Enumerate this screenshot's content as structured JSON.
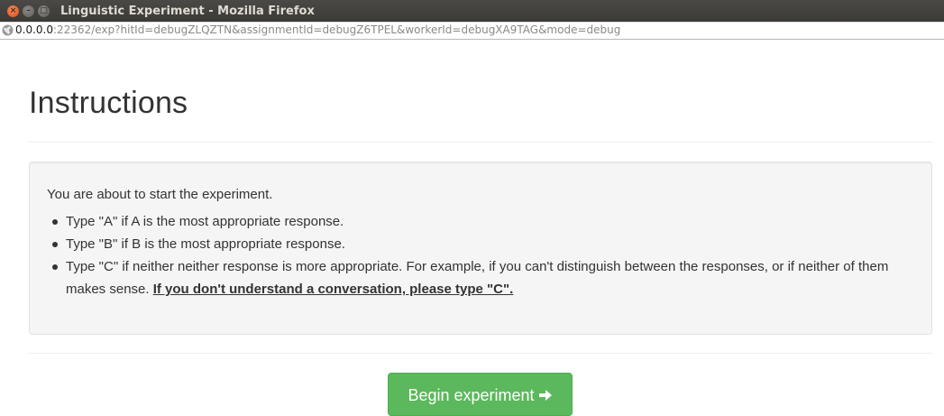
{
  "window": {
    "title": "Linguistic Experiment - Mozilla Firefox",
    "buttons": {
      "close": "×",
      "minimize": "–",
      "maximize": "□"
    }
  },
  "urlbar": {
    "host": "0.0.0.0",
    "rest": ":22362/exp?hitId=debugZLQZTN&assignmentId=debugZ6TPEL&workerId=debugXA9TAG&mode=debug"
  },
  "page": {
    "title": "Instructions",
    "intro": "You are about to start the experiment.",
    "bullets": [
      "Type \"A\" if A is the most appropriate response.",
      "Type \"B\" if B is the most appropriate response.",
      "Type \"C\" if neither neither response is more appropriate. For example, if you can't distinguish between the responses, or if neither of them makes sense."
    ],
    "emphasis": "If you don't understand a conversation, please type \"C\".",
    "begin_button": "Begin experiment"
  },
  "colors": {
    "button_bg": "#5cb85c",
    "well_bg": "#f5f5f5",
    "titlebar_bg": "#3b3a36",
    "close_button": "#df4a16"
  },
  "icons": {
    "close": "close-icon",
    "globe": "globe-icon",
    "arrow": "arrow-right-icon"
  }
}
